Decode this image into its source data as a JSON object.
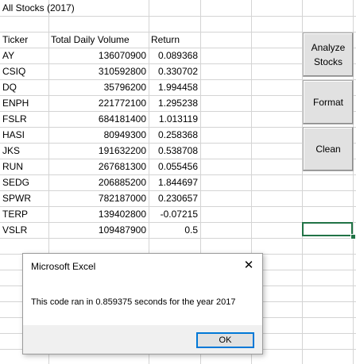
{
  "sheet": {
    "title": "All Stocks (2017)",
    "headers": {
      "ticker": "Ticker",
      "volume": "Total Daily Volume",
      "return": "Return"
    },
    "rows": [
      {
        "ticker": "AY",
        "volume": "136070900",
        "return": "0.089368"
      },
      {
        "ticker": "CSIQ",
        "volume": "310592800",
        "return": "0.330702"
      },
      {
        "ticker": "DQ",
        "volume": "35796200",
        "return": "1.994458"
      },
      {
        "ticker": "ENPH",
        "volume": "221772100",
        "return": "1.295238"
      },
      {
        "ticker": "FSLR",
        "volume": "684181400",
        "return": "1.013119"
      },
      {
        "ticker": "HASI",
        "volume": "80949300",
        "return": "0.258368"
      },
      {
        "ticker": "JKS",
        "volume": "191632200",
        "return": "0.538708"
      },
      {
        "ticker": "RUN",
        "volume": "267681300",
        "return": "0.055456"
      },
      {
        "ticker": "SEDG",
        "volume": "206885200",
        "return": "1.844697"
      },
      {
        "ticker": "SPWR",
        "volume": "782187000",
        "return": "0.230657"
      },
      {
        "ticker": "TERP",
        "volume": "139402800",
        "return": "-0.07215"
      },
      {
        "ticker": "VSLR",
        "volume": "109487900",
        "return": "0.5"
      }
    ]
  },
  "buttons": {
    "analyze_line1": "Analyze",
    "analyze_line2": "Stocks",
    "format": "Format",
    "clean": "Clean"
  },
  "dialog": {
    "title": "Microsoft Excel",
    "close_glyph": "✕",
    "message": "This code ran in 0.859375 seconds for the year 2017",
    "ok_label": "OK"
  },
  "colors": {
    "selection": "#217346",
    "gridline": "#d4d4d4",
    "button_face": "#e1e1e1",
    "focus": "#0078d7"
  }
}
